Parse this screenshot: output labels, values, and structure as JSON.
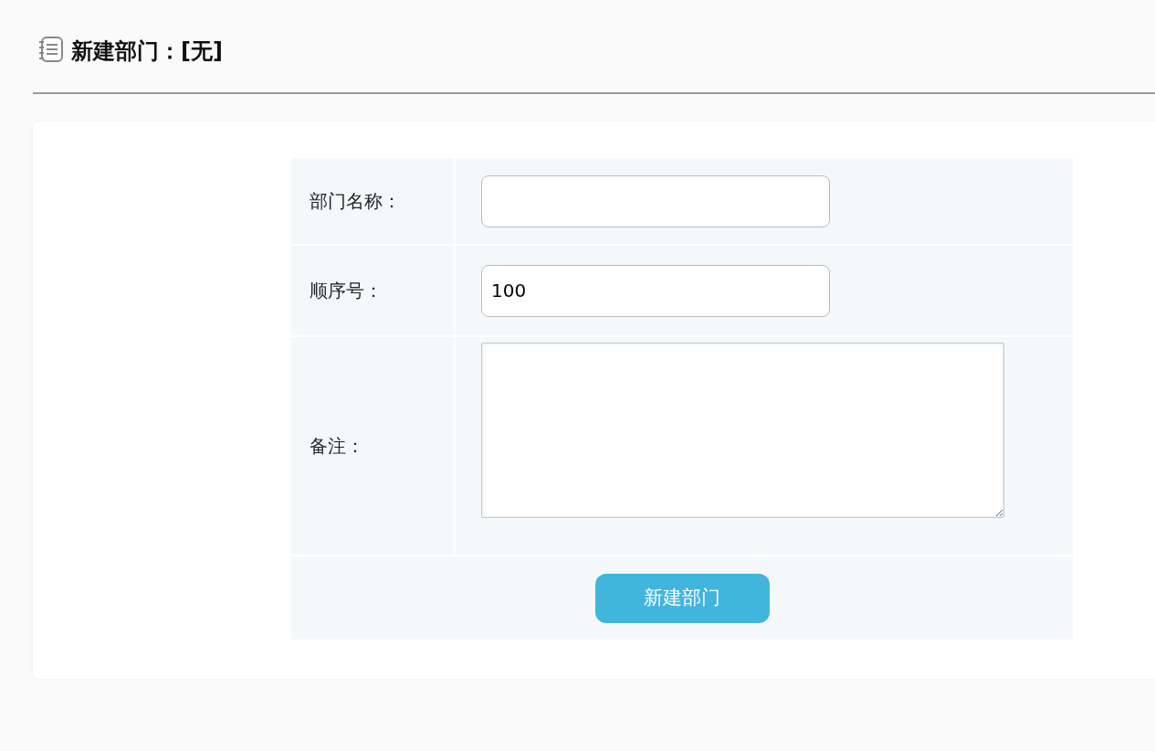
{
  "header": {
    "title": "新建部门：[无]"
  },
  "form": {
    "fields": [
      {
        "kind": "input",
        "label": "部门名称："
      },
      {
        "kind": "input",
        "label": "顺序号：",
        "value": "100"
      },
      {
        "kind": "textarea",
        "label": "备注："
      }
    ],
    "submit": "新建部门"
  }
}
